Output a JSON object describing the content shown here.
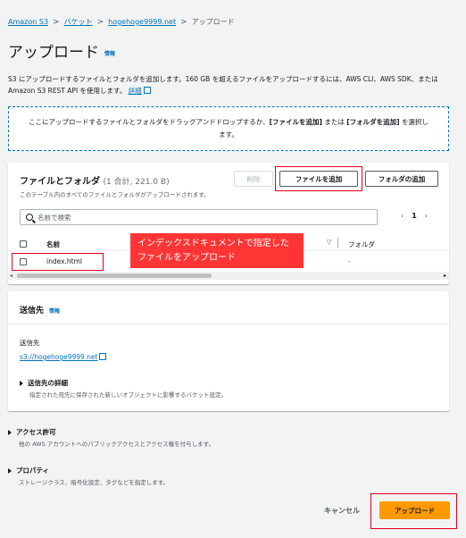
{
  "breadcrumb": {
    "items": [
      "Amazon S3",
      "バケット",
      "hogehoge9999.net",
      "アップロード"
    ],
    "separator": ">"
  },
  "header": {
    "title": "アップロード",
    "info": "情報"
  },
  "description": {
    "text": "S3 にアップロードするファイルとフォルダを追加します。160 GB を超えるファイルをアップロードするには、AWS CLI、AWS SDK、または Amazon S3 REST API を使用します。",
    "link": "詳細"
  },
  "dropzone": {
    "text_before": "ここにアップロードするファイルとフォルダをドラッグアンドドロップするか、",
    "add_files": "[ファイルを追加]",
    "middle": " または ",
    "add_folder": "[フォルダを追加]",
    "text_after": " を選択します。"
  },
  "files_panel": {
    "title": "ファイルとフォルダ",
    "count": "(1 合計, 221.0 B)",
    "subtitle": "このテーブル内のすべてのファイルとフォルダがアップロードされます。",
    "delete_button": "削除",
    "add_files_button": "ファイルを追加",
    "add_folder_button": "フォルダの追加",
    "search_placeholder": "名前で検索",
    "pager": {
      "prev": "‹",
      "page": "1",
      "next": "›"
    },
    "columns": {
      "name": "名前",
      "folder": "フォルダ"
    },
    "rows": [
      {
        "name": "index.html",
        "folder": "-"
      }
    ]
  },
  "callout": {
    "text": "インデックスドキュメントで指定したファイルをアップロード"
  },
  "destination": {
    "title": "送信先",
    "info": "情報",
    "label": "送信先",
    "link": "s3://hogehoge9999.net",
    "details_title": "送信先の詳細",
    "details_desc": "指定された宛先に保存された新しいオブジェクトに影響するバケット設定。"
  },
  "permissions": {
    "title": "アクセス許可",
    "desc": "他の AWS アカウントへのパブリックアクセスとアクセス権を付与します。"
  },
  "properties": {
    "title": "プロパティ",
    "desc": "ストレージクラス、暗号化設定、タグなどを指定します。"
  },
  "footer": {
    "cancel": "キャンセル",
    "upload": "アップロード"
  },
  "colors": {
    "link": "#0073bb",
    "primary": "#ff9900",
    "callout": "#ff3535",
    "highlight": "#e6001e"
  }
}
